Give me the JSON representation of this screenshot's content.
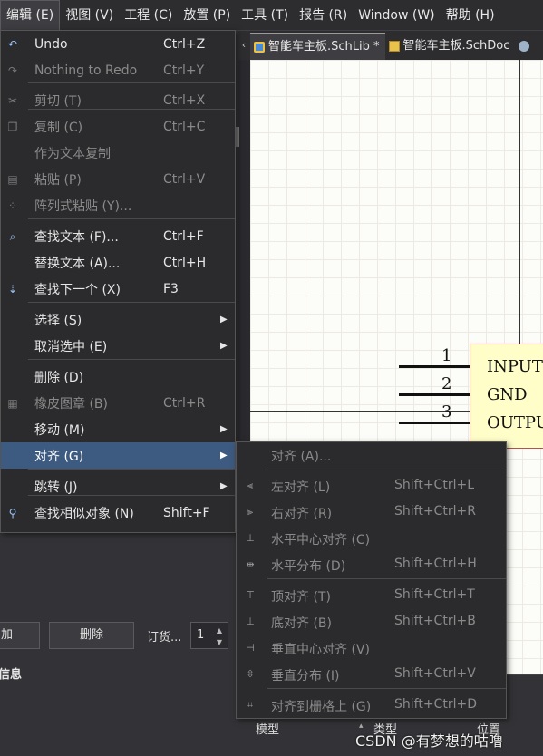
{
  "menubar": {
    "items": [
      {
        "label": "编辑 (E)",
        "active": true
      },
      {
        "label": "视图 (V)",
        "active": false
      },
      {
        "label": "工程 (C)",
        "active": false
      },
      {
        "label": "放置 (P)",
        "active": false
      },
      {
        "label": "工具 (T)",
        "active": false
      },
      {
        "label": "报告 (R)",
        "active": false
      },
      {
        "label": "Window (W)",
        "active": false
      },
      {
        "label": "帮助 (H)",
        "active": false
      }
    ]
  },
  "tabs": {
    "scroll_arrow": "‹",
    "items": [
      {
        "label": "智能车主板.SchLib *",
        "icon": "schlib-icon",
        "active": true
      },
      {
        "label": "智能车主板.SchDoc",
        "icon": "schdoc-icon",
        "active": false
      },
      {
        "label": "",
        "icon": "gear-icon",
        "active": false
      }
    ]
  },
  "edit_menu": {
    "items": [
      {
        "label": "Undo",
        "shortcut": "Ctrl+Z",
        "icon": "undo-icon",
        "glyph": "↶",
        "disabled": false
      },
      {
        "label": "Nothing to Redo",
        "shortcut": "Ctrl+Y",
        "icon": "redo-icon",
        "glyph": "↷",
        "disabled": true
      },
      {
        "label": "剪切 (T)",
        "shortcut": "Ctrl+X",
        "icon": "cut-icon",
        "glyph": "✂",
        "disabled": true
      },
      {
        "label": "复制 (C)",
        "shortcut": "Ctrl+C",
        "icon": "copy-icon",
        "glyph": "❐",
        "disabled": true
      },
      {
        "label": "作为文本复制",
        "shortcut": "",
        "icon": "",
        "glyph": "",
        "disabled": true
      },
      {
        "label": "粘贴 (P)",
        "shortcut": "Ctrl+V",
        "icon": "paste-icon",
        "glyph": "▤",
        "disabled": true
      },
      {
        "label": "阵列式粘贴 (Y)...",
        "shortcut": "",
        "icon": "array-paste-icon",
        "glyph": "⁘",
        "disabled": true
      },
      {
        "label": "查找文本 (F)...",
        "shortcut": "Ctrl+F",
        "icon": "binoculars-icon",
        "glyph": "⌕",
        "disabled": false
      },
      {
        "label": "替换文本 (A)...",
        "shortcut": "Ctrl+H",
        "icon": "",
        "glyph": "",
        "disabled": false
      },
      {
        "label": "查找下一个 (X)",
        "shortcut": "F3",
        "icon": "find-next-icon",
        "glyph": "⇣",
        "disabled": false
      },
      {
        "label": "选择 (S)",
        "shortcut": "",
        "icon": "",
        "glyph": "",
        "disabled": false,
        "submenu": true
      },
      {
        "label": "取消选中 (E)",
        "shortcut": "",
        "icon": "",
        "glyph": "",
        "disabled": false,
        "submenu": true
      },
      {
        "label": "删除 (D)",
        "shortcut": "",
        "icon": "",
        "glyph": "",
        "disabled": false
      },
      {
        "label": "橡皮图章 (B)",
        "shortcut": "Ctrl+R",
        "icon": "stamp-icon",
        "glyph": "▦",
        "disabled": true
      },
      {
        "label": "移动 (M)",
        "shortcut": "",
        "icon": "",
        "glyph": "",
        "disabled": false,
        "submenu": true
      },
      {
        "label": "对齐 (G)",
        "shortcut": "",
        "icon": "",
        "glyph": "",
        "disabled": false,
        "submenu": true,
        "highlighted": true
      },
      {
        "label": "跳转 (J)",
        "shortcut": "",
        "icon": "",
        "glyph": "",
        "disabled": false,
        "submenu": true
      },
      {
        "label": "查找相似对象 (N)",
        "shortcut": "Shift+F",
        "icon": "find-similar-icon",
        "glyph": "⚲",
        "disabled": false
      }
    ],
    "submenu_arrow": "▶"
  },
  "align_submenu": {
    "items": [
      {
        "label": "对齐 (A)...",
        "shortcut": "",
        "icon": "",
        "glyph": ""
      },
      {
        "label": "左对齐 (L)",
        "shortcut": "Shift+Ctrl+L",
        "icon": "align-left-icon",
        "glyph": "⫷"
      },
      {
        "label": "右对齐 (R)",
        "shortcut": "Shift+Ctrl+R",
        "icon": "align-right-icon",
        "glyph": "⫸"
      },
      {
        "label": "水平中心对齐 (C)",
        "shortcut": "",
        "icon": "align-hcenter-icon",
        "glyph": "⊥"
      },
      {
        "label": "水平分布 (D)",
        "shortcut": "Shift+Ctrl+H",
        "icon": "distribute-h-icon",
        "glyph": "⇹"
      },
      {
        "label": "顶对齐 (T)",
        "shortcut": "Shift+Ctrl+T",
        "icon": "align-top-icon",
        "glyph": "⊤"
      },
      {
        "label": "底对齐 (B)",
        "shortcut": "Shift+Ctrl+B",
        "icon": "align-bottom-icon",
        "glyph": "⊥"
      },
      {
        "label": "垂直中心对齐 (V)",
        "shortcut": "",
        "icon": "align-vcenter-icon",
        "glyph": "⊣"
      },
      {
        "label": "垂直分布 (I)",
        "shortcut": "Shift+Ctrl+V",
        "icon": "distribute-v-icon",
        "glyph": "⇳"
      },
      {
        "label": "对齐到栅格上 (G)",
        "shortcut": "Shift+Ctrl+D",
        "icon": "align-grid-icon",
        "glyph": "⌗"
      }
    ]
  },
  "component": {
    "pins": [
      {
        "number": "1",
        "name": "INPUT"
      },
      {
        "number": "2",
        "name": "GND"
      },
      {
        "number": "3",
        "name": "OUTPUT"
      }
    ]
  },
  "left_panel": {
    "add_button": "加",
    "delete_button": "删除",
    "order_label": "订货...",
    "quantity": "1",
    "info_label": "信息"
  },
  "bottom_panel": {
    "columns": [
      "模型",
      "类型",
      "位置"
    ]
  },
  "watermark": "CSDN @有梦想的咕噜",
  "colors": {
    "menu_highlight": "#3d5a80",
    "component_fill": "#fffdc8",
    "component_border": "#b5534a"
  }
}
